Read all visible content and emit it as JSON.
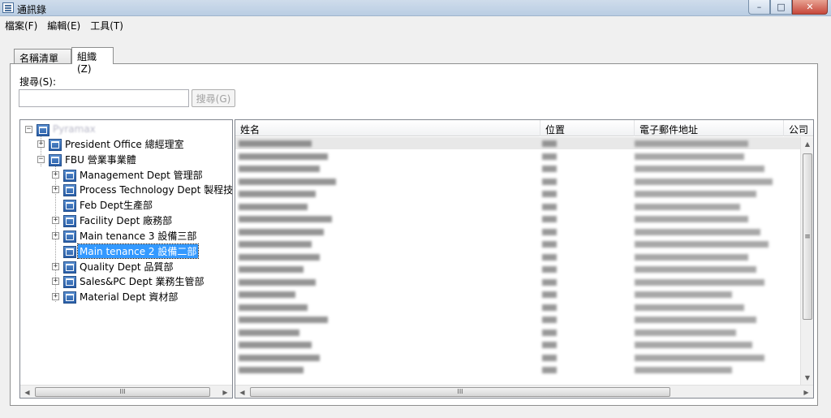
{
  "window": {
    "title": "通訊錄",
    "buttons": [
      "–",
      "□",
      "✕"
    ]
  },
  "menu": [
    {
      "label": "檔案(F)"
    },
    {
      "label": "編輯(E)"
    },
    {
      "label": "工具(T)"
    }
  ],
  "tabs": [
    {
      "label": "名稱清單(M)",
      "active": false
    },
    {
      "label": "組織(Z)",
      "active": true
    }
  ],
  "search": {
    "label": "搜尋(S):",
    "value": "",
    "button_label": "搜尋(G)"
  },
  "tree": {
    "root": "Pyramax",
    "nodes": [
      {
        "label": "President Office 總經理室",
        "level": 1,
        "expander": "+"
      },
      {
        "label": "FBU 營業事業體",
        "level": 1,
        "expander": "−"
      },
      {
        "label": "Management Dept 管理部",
        "level": 2,
        "expander": "+"
      },
      {
        "label": "Process Technology Dept 製程技術",
        "level": 2,
        "expander": "+"
      },
      {
        "label": "Feb Dept生產部",
        "level": 2,
        "expander": ""
      },
      {
        "label": "Facility Dept 廠務部",
        "level": 2,
        "expander": "+"
      },
      {
        "label": "Main tenance 3 設備三部",
        "level": 2,
        "expander": "+"
      },
      {
        "label": "Main tenance 2 設備二部",
        "level": 2,
        "expander": "",
        "selected": true
      },
      {
        "label": "Quality Dept 品質部",
        "level": 2,
        "expander": "+"
      },
      {
        "label": "Sales&PC Dept 業務生管部",
        "level": 2,
        "expander": "+"
      },
      {
        "label": "Material Dept 資材部",
        "level": 2,
        "expander": "+"
      }
    ]
  },
  "list": {
    "columns": [
      "姓名",
      "位置",
      "電子郵件地址",
      "公司"
    ],
    "row_count": 19
  },
  "colors": {
    "selection": "#3399ff",
    "accent": "#2a5fa8"
  },
  "scrollbar_thumb_glyph": "III",
  "vscroll_thumb_glyph": "≡"
}
